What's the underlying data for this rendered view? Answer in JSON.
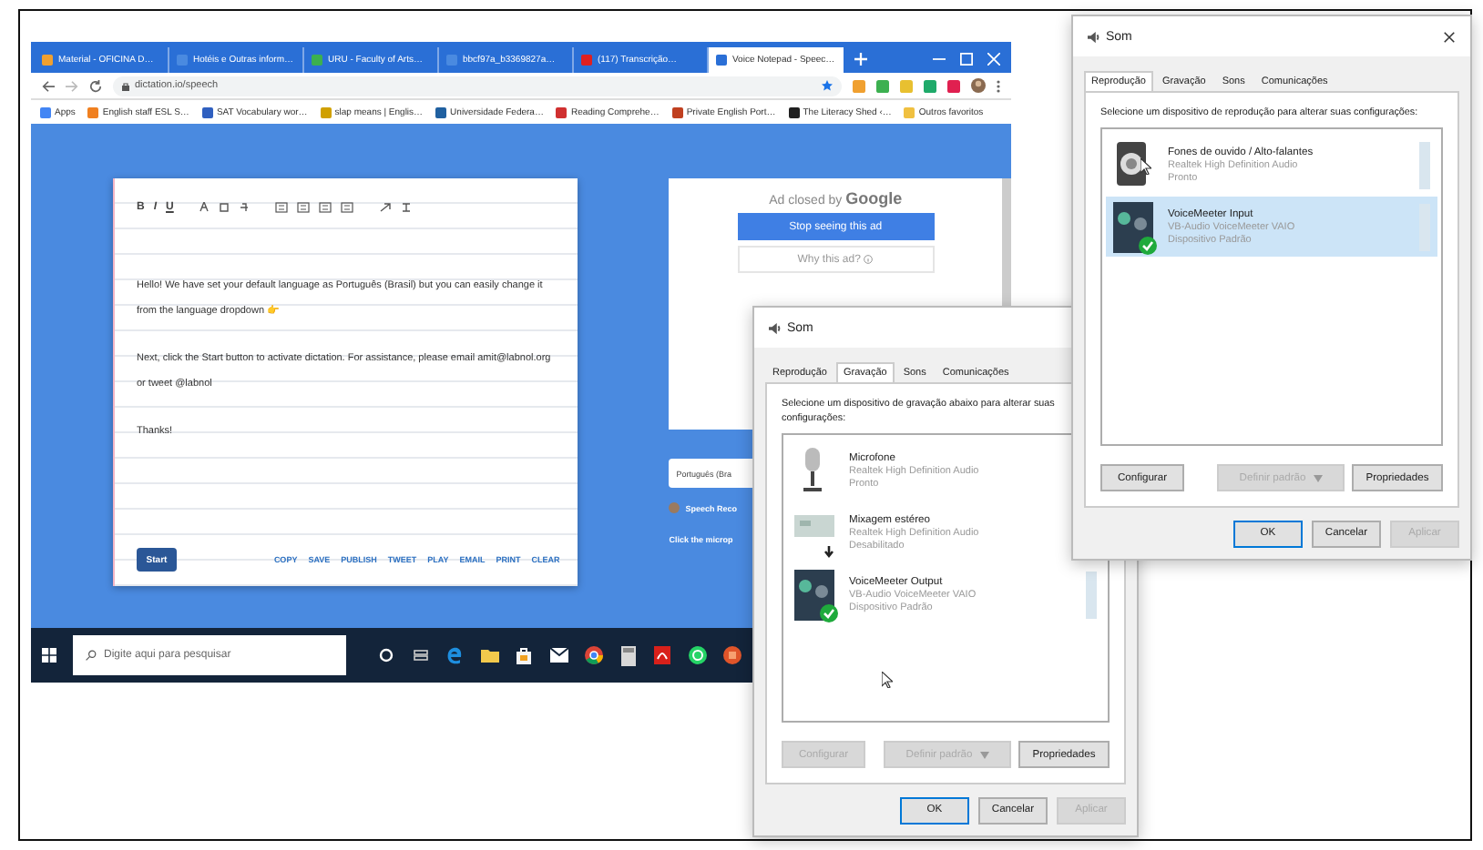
{
  "browser": {
    "tabs": [
      {
        "title": "Material - OFICINA D…",
        "selected": false,
        "color": "#f0a030"
      },
      {
        "title": "Hotéis e Outras inform…",
        "selected": false,
        "color": "#4a8ae0"
      },
      {
        "title": "URU - Faculty of Arts…",
        "selected": false,
        "color": "#3cb050"
      },
      {
        "title": "bbcf97a_b3369827a…",
        "selected": false,
        "color": "#4a8ae0"
      },
      {
        "title": "(117) Transcrição…",
        "selected": false,
        "color": "#e02020"
      },
      {
        "title": "Voice Notepad - Speec…",
        "selected": true,
        "color": "#2a6fd6"
      }
    ],
    "address": "dictation.io/speech",
    "bookmarks": [
      {
        "label": "Apps",
        "color": "#4285f4"
      },
      {
        "label": "English staff ESL S…",
        "color": "#f08020"
      },
      {
        "label": "SAT Vocabulary wor…",
        "color": "#3060c0"
      },
      {
        "label": "slap means | Englis…",
        "color": "#d0a000"
      },
      {
        "label": "Universidade Federa…",
        "color": "#2060a0"
      },
      {
        "label": "Reading Comprehe…",
        "color": "#d03030"
      },
      {
        "label": "Private English Port…",
        "color": "#c04020"
      },
      {
        "label": "The Literacy Shed ‹…",
        "color": "#202020"
      },
      {
        "label": "Outros favoritos",
        "color": "#f0c040"
      }
    ]
  },
  "editor": {
    "format_buttons": [
      "B",
      "I",
      "U"
    ],
    "paragraphs": [
      "Hello! We have set your default language as Português (Brasil) but you can easily change it from the language dropdown 👉",
      "Next, click the Start button to activate dictation. For assistance, please email amit@labnol.org or tweet @labnol",
      "Thanks!"
    ],
    "start": "Start",
    "actions": [
      "COPY",
      "SAVE",
      "PUBLISH",
      "TWEET",
      "PLAY",
      "EMAIL",
      "PRINT",
      "CLEAR"
    ]
  },
  "ad": {
    "closed_by": "Ad closed by",
    "brand": "Google",
    "stop": "Stop seeing this ad",
    "why": "Why this ad?"
  },
  "side": {
    "language": "Português (Bra",
    "speech": "Speech Reco",
    "hint": "Click the microp"
  },
  "taskbar": {
    "search_placeholder": "Digite aqui para pesquisar",
    "apps": [
      {
        "kind": "cortana"
      },
      {
        "kind": "taskview"
      },
      {
        "kind": "edge"
      },
      {
        "kind": "explorer"
      },
      {
        "kind": "store"
      },
      {
        "kind": "mail"
      },
      {
        "kind": "chrome"
      },
      {
        "kind": "calculator"
      },
      {
        "kind": "acrobat"
      },
      {
        "kind": "whatsapp"
      },
      {
        "kind": "office"
      }
    ]
  },
  "sound_dialogs": [
    {
      "title": "Som",
      "tabs": [
        {
          "label": "Reprodução",
          "selected": true
        },
        {
          "label": "Gravação",
          "selected": false
        },
        {
          "label": "Sons",
          "selected": false
        },
        {
          "label": "Comunicações",
          "selected": false
        }
      ],
      "instruction": "Selecione um dispositivo de reprodução para alterar suas configurações:",
      "devices": [
        {
          "kind": "speaker",
          "name": "Fones de ouvido / Alto-falantes",
          "driver": "Realtek High Definition Audio",
          "status": "Pronto",
          "selected": false,
          "default": false,
          "disabled": false
        },
        {
          "kind": "voicemeeter",
          "name": "VoiceMeeter Input",
          "driver": "VB-Audio VoiceMeeter VAIO",
          "status": "Dispositivo Padrão",
          "selected": true,
          "default": true,
          "disabled": false
        }
      ],
      "configure": {
        "label": "Configurar",
        "disabled": false
      },
      "set_default": {
        "label": "Definir padrão",
        "disabled": true
      },
      "properties": "Propriedades",
      "ok": "OK",
      "cancel": "Cancelar",
      "apply": {
        "label": "Aplicar",
        "disabled": true
      }
    },
    {
      "title": "Som",
      "tabs": [
        {
          "label": "Reprodução",
          "selected": false
        },
        {
          "label": "Gravação",
          "selected": true
        },
        {
          "label": "Sons",
          "selected": false
        },
        {
          "label": "Comunicações",
          "selected": false
        }
      ],
      "instruction": "Selecione um dispositivo de gravação abaixo para alterar suas configurações:",
      "devices": [
        {
          "kind": "microphone",
          "name": "Microfone",
          "driver": "Realtek High Definition Audio",
          "status": "Pronto",
          "selected": false,
          "default": false,
          "disabled": false
        },
        {
          "kind": "mixer",
          "name": "Mixagem estéreo",
          "driver": "Realtek High Definition Audio",
          "status": "Desabilitado",
          "selected": false,
          "default": false,
          "disabled": true
        },
        {
          "kind": "voicemeeter",
          "name": "VoiceMeeter Output",
          "driver": "VB-Audio VoiceMeeter VAIO",
          "status": "Dispositivo Padrão",
          "selected": false,
          "default": true,
          "disabled": false
        }
      ],
      "configure": {
        "label": "Configurar",
        "disabled": true
      },
      "set_default": {
        "label": "Definir padrão",
        "disabled": true
      },
      "properties": "Propriedades",
      "ok": "OK",
      "cancel": "Cancelar",
      "apply": {
        "label": "Aplicar",
        "disabled": true
      }
    }
  ]
}
